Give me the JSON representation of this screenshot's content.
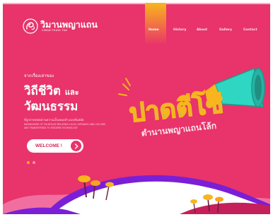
{
  "brand": {
    "name": "วิมานพญาแถน",
    "sub": "VIMAN PHAYA TAN"
  },
  "nav": {
    "items": [
      {
        "label": "Home",
        "active": true
      },
      {
        "label": "History",
        "active": false
      },
      {
        "label": "About",
        "active": false
      },
      {
        "label": "Gallery",
        "active": false
      },
      {
        "label": "Contact",
        "active": false
      }
    ]
  },
  "hero": {
    "kicker": "จากเรื่องเล่าของ",
    "headline_line1_big": "วิถีชีวิต",
    "headline_line1_small": "และ",
    "headline_line2": "วัฒนธรรม",
    "desc_th": "ที่ถูกถ่ายทอดผ่านความเป็นหมอลำแบบทันสมัย",
    "desc_en": "KNOWLEDGE OF FOLKTALES RELATING LOCAL LIFEWAYS AND CULTURE ARE TRANSFERRED TO MODERN TECHNOLOGY",
    "cta_label": "WELCOME !",
    "art_title": "ปาดตีโซ่",
    "art_subtitle": "ตำนานพญาแถนโล้ก"
  },
  "carousel": {
    "total": 2,
    "active_index": 0
  },
  "colors": {
    "background": "#e8336b",
    "accent_yellow": "#f8b51d",
    "accent_orange": "#f27b3f",
    "accent_teal": "#2fd6c1",
    "text_on_accent": "#ffffff"
  },
  "icons": {
    "logo": "serpent-naga-logo-icon",
    "cta": "arrow-right-icon",
    "art": "megaphone-icon"
  }
}
